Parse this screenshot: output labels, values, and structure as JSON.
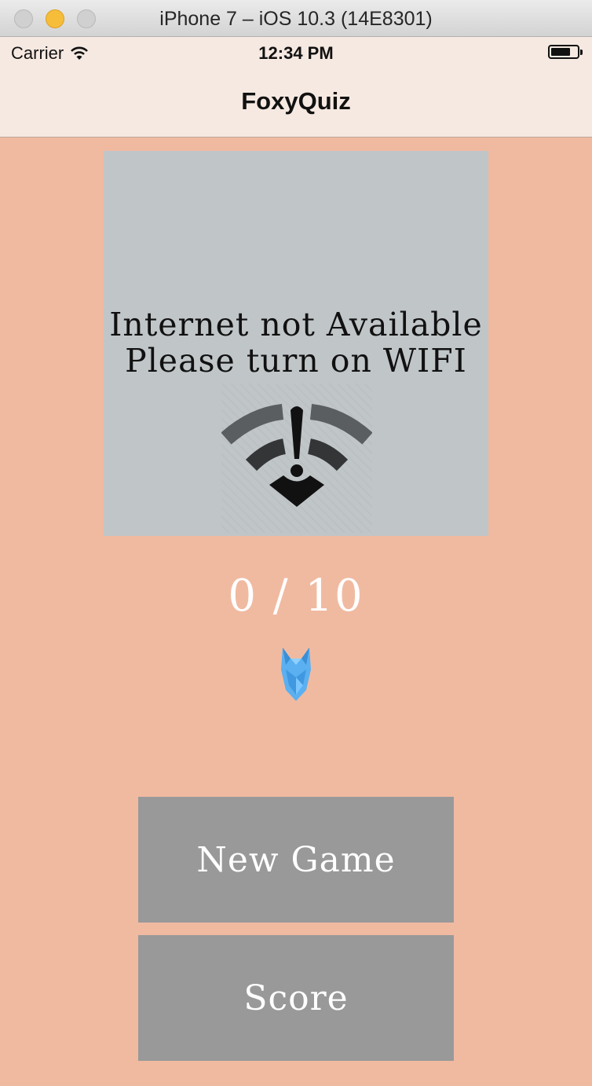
{
  "window": {
    "title": "iPhone 7 – iOS 10.3 (14E8301)"
  },
  "status_bar": {
    "carrier": "Carrier",
    "time": "12:34 PM"
  },
  "nav": {
    "title": "FoxyQuiz"
  },
  "quiz_image": {
    "line1": "Internet not Available",
    "line2": "Please turn on WIFI",
    "icon": "wifi-warning-icon"
  },
  "progress": {
    "text": "0 / 10"
  },
  "mascot": {
    "icon": "fox-logo-icon"
  },
  "buttons": {
    "new_game": "New Game",
    "score": "Score"
  },
  "colors": {
    "background": "#f0baa1",
    "nav_background": "#f6e9e1",
    "button": "#999999",
    "mascot": "#5ab0f0"
  }
}
